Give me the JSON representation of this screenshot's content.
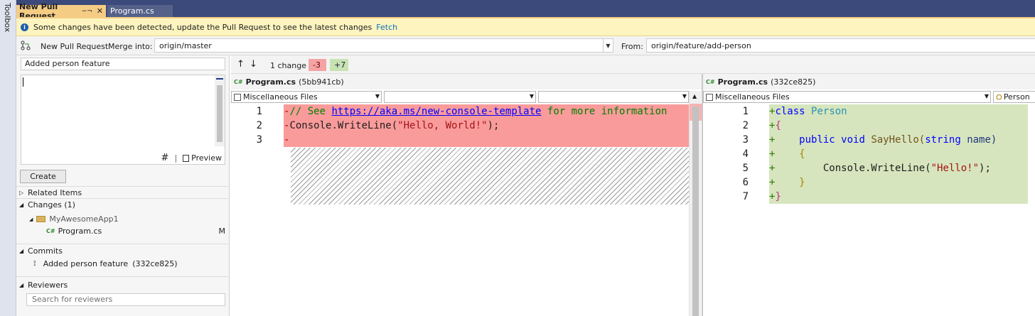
{
  "toolbox": {
    "label": "Toolbox"
  },
  "tabs": [
    {
      "label": "New Pull Request",
      "pin": "−¬",
      "close": "✕"
    },
    {
      "label": "Program.cs"
    }
  ],
  "infobar": {
    "message": "Some changes have been detected, update the Pull Request to see the latest changes",
    "action": "Fetch"
  },
  "pr_toolbar": {
    "title": "New Pull Request",
    "merge_into_label": "Merge into:",
    "merge_into_value": "origin/master",
    "from_label": "From:",
    "from_value": "origin/feature/add-person"
  },
  "pr_form": {
    "title_value": "Added person feature",
    "description_value": "",
    "markdown_icon": "#",
    "preview_label": "Preview",
    "create_label": "Create"
  },
  "sections": {
    "related_items": "Related Items",
    "changes": "Changes (1)",
    "commits": "Commits",
    "reviewers": "Reviewers"
  },
  "changes_tree": {
    "folder": "MyAwesomeApp1",
    "file": "Program.cs",
    "file_status": "M",
    "file_icon": "C#"
  },
  "commits": [
    {
      "message": "Added person feature",
      "hash": "(332ce825)"
    }
  ],
  "reviewers": {
    "placeholder": "Search for reviewers"
  },
  "diff_header": {
    "change_count": "1 change",
    "deletions": "-3",
    "additions": "+7"
  },
  "left_file": {
    "icon": "C#",
    "name": "Program.cs",
    "commit": "(5bb941cb)",
    "nav1": "Miscellaneous Files",
    "nav2": "",
    "nav3": ""
  },
  "right_file": {
    "icon": "C#",
    "name": "Program.cs",
    "commit": "(332ce825)",
    "nav1": "Miscellaneous Files",
    "nav2": "Person"
  },
  "left_lines": {
    "n1": "1",
    "n2": "2",
    "n3": "3",
    "m1": "-",
    "m2": "-",
    "m3": "-",
    "l1_a": "// See ",
    "l1_link": "https://aka.ms/new-console-template",
    "l1_b": " for more information",
    "l2_a": "Console.WriteLine(",
    "l2_str": "\"Hello, World!\"",
    "l2_b": ");"
  },
  "right_lines": {
    "n1": "1",
    "n2": "2",
    "n3": "3",
    "n4": "4",
    "n5": "5",
    "n6": "6",
    "n7": "7",
    "p": "+",
    "r1_kw": "class",
    "r1_type": "Person",
    "r2": "{",
    "r3_kw1": "public",
    "r3_kw2": "void",
    "r3_name": "SayHello(",
    "r3_kw3": "string",
    "r3_end": "name)",
    "r4": "{",
    "r5_a": "Console.WriteLine(",
    "r5_str": "\"Hello!\"",
    "r5_b": ");",
    "r6": "}",
    "r7": "}"
  },
  "colors": {
    "tab_active": "#f5cc84",
    "tabbar": "#3b4a7a",
    "deleted_line": "#fa9b9b",
    "added_line": "#d6e5bd",
    "infobar": "#fdf4bf"
  }
}
